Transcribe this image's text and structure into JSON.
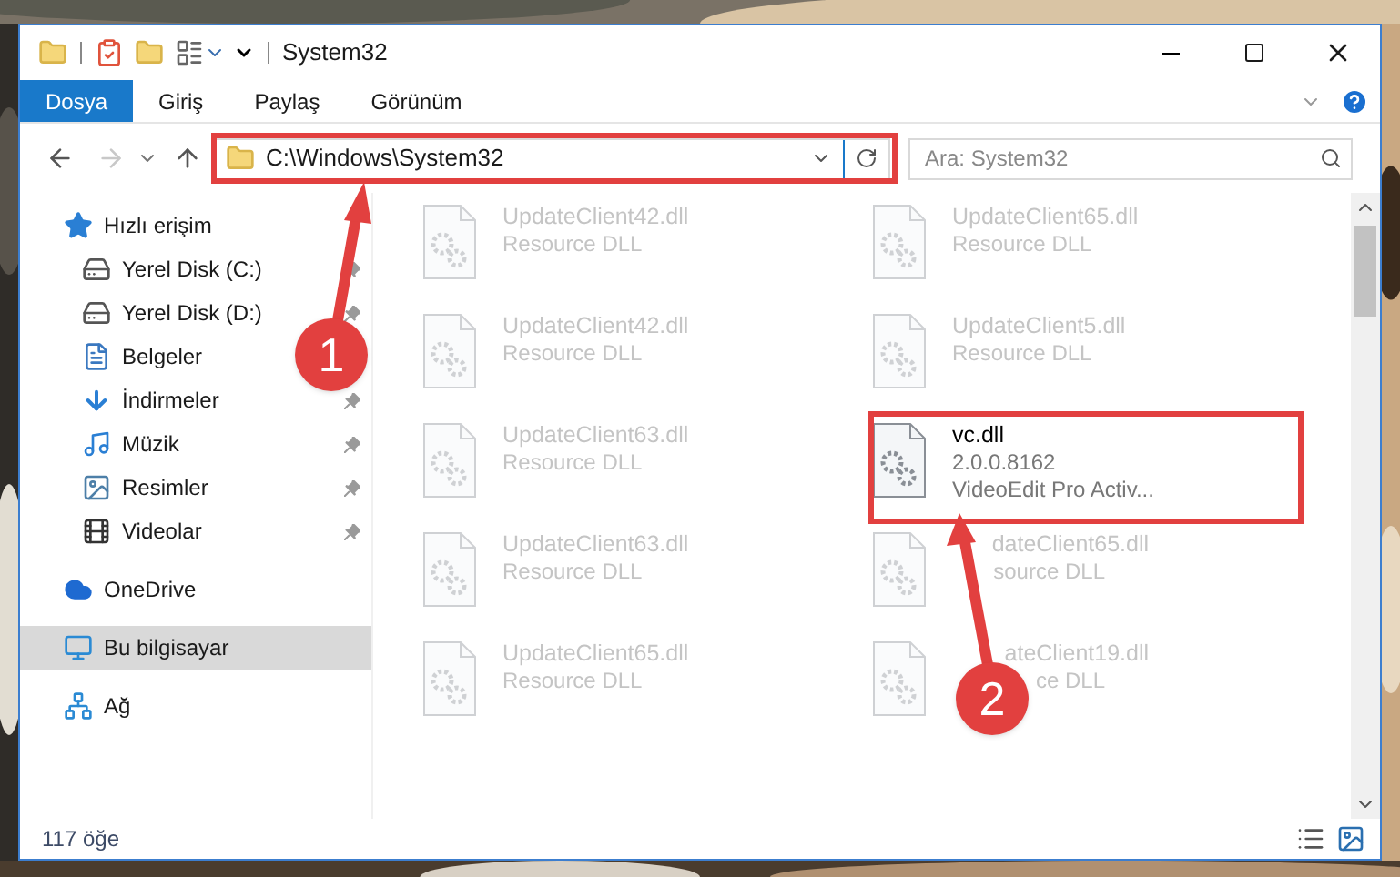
{
  "window": {
    "title": "System32"
  },
  "tabs": [
    {
      "label": "Dosya",
      "kind": "file"
    },
    {
      "label": "Giriş",
      "kind": "tab"
    },
    {
      "label": "Paylaş",
      "kind": "tab"
    },
    {
      "label": "Görünüm",
      "kind": "tab"
    }
  ],
  "address": {
    "value": "C:\\Windows\\System32"
  },
  "search": {
    "placeholder": "Ara: System32"
  },
  "sidebar": {
    "items": [
      {
        "label": "Hızlı erişim",
        "kind": "quick",
        "children": [
          {
            "label": "Yerel Disk (C:)",
            "kind": "drive-c",
            "pinned": true
          },
          {
            "label": "Yerel Disk (D:)",
            "kind": "drive",
            "pinned": true
          },
          {
            "label": "Belgeler",
            "kind": "documents"
          },
          {
            "label": "İndirmeler",
            "kind": "downloads",
            "pinned": true
          },
          {
            "label": "Müzik",
            "kind": "music",
            "pinned": true
          },
          {
            "label": "Resimler",
            "kind": "pictures",
            "pinned": true
          },
          {
            "label": "Videolar",
            "kind": "videos",
            "pinned": true
          }
        ]
      },
      {
        "label": "OneDrive",
        "kind": "cloud",
        "selected": false
      },
      {
        "label": "Bu bilgisayar",
        "kind": "computer",
        "selected": true
      },
      {
        "label": "Ağ",
        "kind": "network",
        "selected": false
      }
    ]
  },
  "files": [
    {
      "name": "UpdateClient42.dll",
      "lines": [
        "Resource DLL"
      ],
      "faded": true,
      "covered": false
    },
    {
      "name": "UpdateClient65.dll",
      "lines": [
        "Resource DLL"
      ],
      "faded": true,
      "covered": false
    },
    {
      "name": "UpdateClient42.dll",
      "lines": [
        "Resource DLL"
      ],
      "faded": true,
      "covered": false
    },
    {
      "name": "UpdateClient5.dll",
      "lines": [
        "Resource DLL"
      ],
      "faded": true,
      "covered": false
    },
    {
      "name": "UpdateClient63.dll",
      "lines": [
        "Resource DLL"
      ],
      "faded": true,
      "covered": false
    },
    {
      "name": "vc.dll",
      "lines": [
        "2.0.0.8162",
        "VideoEdit Pro Activ..."
      ],
      "faded": false,
      "covered": false
    },
    {
      "name": "UpdateClient63.dll",
      "lines": [
        "Resource DLL"
      ],
      "faded": true,
      "covered": false
    },
    {
      "name": "dateClient65.dll",
      "lines": [
        "source DLL"
      ],
      "faded": true,
      "covered": true
    },
    {
      "name": "UpdateClient65.dll",
      "lines": [
        "Resource DLL"
      ],
      "faded": true,
      "covered": false
    },
    {
      "name": "ateClient19.dll",
      "lines": [
        "ce DLL"
      ],
      "faded": true,
      "covered": true
    }
  ],
  "callouts": [
    {
      "label": "1"
    },
    {
      "label": "2"
    }
  ],
  "status_bar": {
    "count": "117 öğe"
  }
}
